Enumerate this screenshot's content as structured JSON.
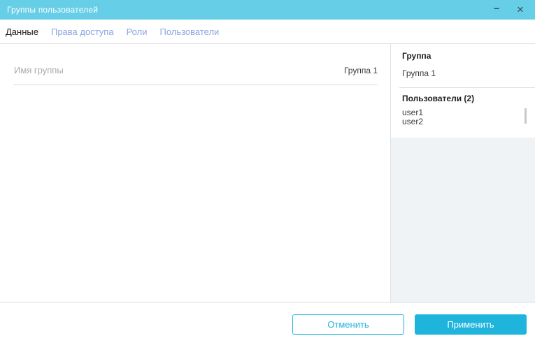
{
  "window": {
    "title": "Группы пользователей",
    "controls": {
      "minimize_icon": "–",
      "close_icon": "×"
    }
  },
  "tabs": {
    "items": [
      {
        "label": "Данные",
        "active": true
      },
      {
        "label": "Права доступа",
        "active": false
      },
      {
        "label": "Роли",
        "active": false
      },
      {
        "label": "Пользователи",
        "active": false
      }
    ]
  },
  "main": {
    "group_name_field": {
      "placeholder": "Имя группы",
      "value": "Группа 1"
    }
  },
  "sidebar": {
    "group_section": {
      "title": "Группа",
      "value": "Группа 1"
    },
    "users_section": {
      "title": "Пользователи (2)",
      "items": [
        "user1",
        "user2"
      ]
    }
  },
  "footer": {
    "cancel_label": "Отменить",
    "apply_label": "Применить"
  },
  "colors": {
    "titlebar_bg": "#67CEE7",
    "titlebar_text": "#FFFFFF",
    "accent": "#1FB4DC",
    "tab_inactive": "#8AA6E2",
    "tab_active": "#1A1A1A",
    "sidebar_bg": "#F0F3F5",
    "divider": "#E0E0E0",
    "placeholder": "#A9A9A9",
    "text": "#3A3A3A",
    "control_icon": "#37474F"
  }
}
